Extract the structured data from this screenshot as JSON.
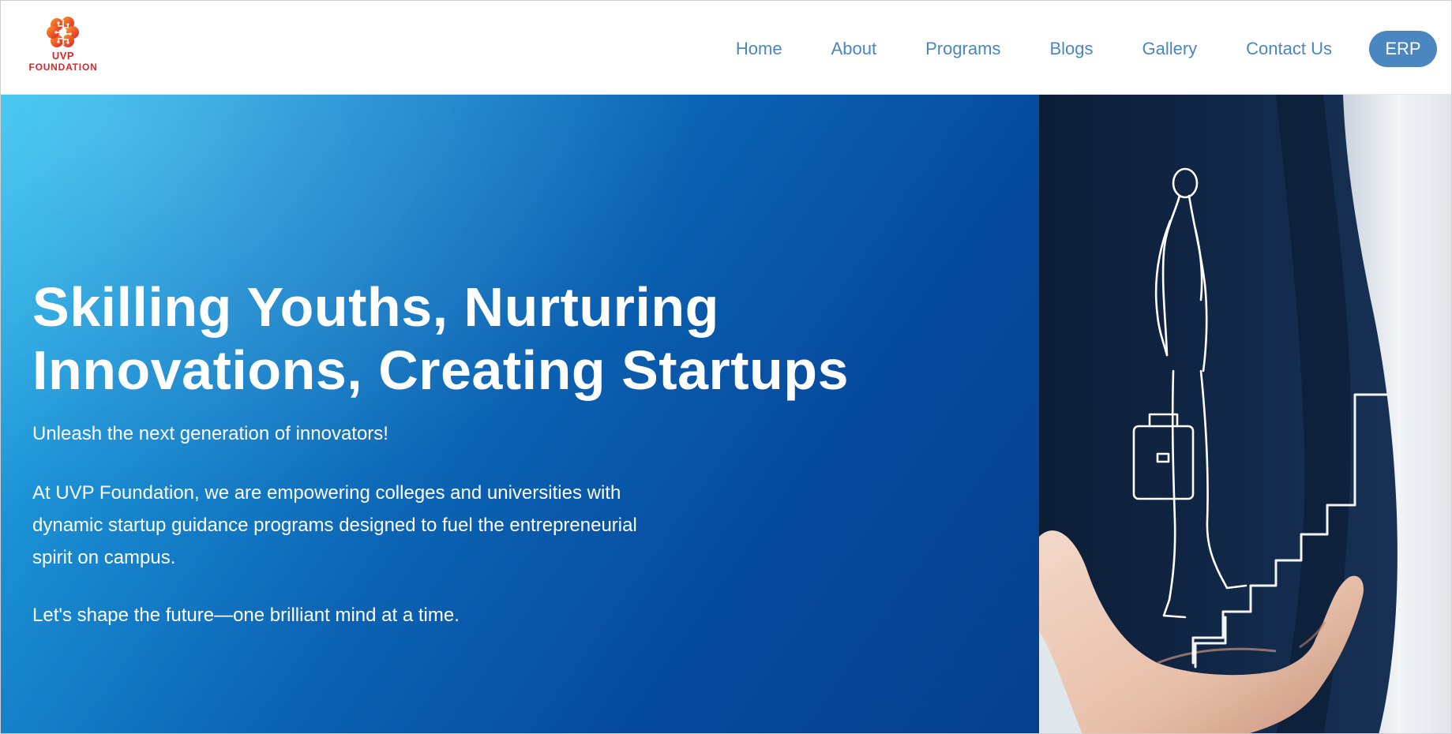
{
  "logo": {
    "line1": "UVP",
    "line2": "FOUNDATION"
  },
  "nav": {
    "items": [
      {
        "label": "Home"
      },
      {
        "label": "About"
      },
      {
        "label": "Programs"
      },
      {
        "label": "Blogs"
      },
      {
        "label": "Gallery"
      },
      {
        "label": "Contact Us"
      }
    ],
    "erp_label": "ERP"
  },
  "hero": {
    "title_line1": "Skilling Youths, Nurturing",
    "title_line2": "Innovations, Creating Startups",
    "tagline": "Unleash the next generation of innovators!",
    "paragraph": "At UVP Foundation, we are empowering colleges and universities with dynamic startup guidance programs designed to fuel the entrepreneurial spirit on campus.",
    "closing": "Let's shape the future—one brilliant mind at a time."
  },
  "colors": {
    "nav_link": "#4a86bf",
    "erp_button": "#4a86bf",
    "logo_red": "#d8262e",
    "hero_gradient_start": "#29c0ef",
    "hero_gradient_end": "#053f8d"
  },
  "icons": {
    "logo": "brain-circuit-icon"
  }
}
